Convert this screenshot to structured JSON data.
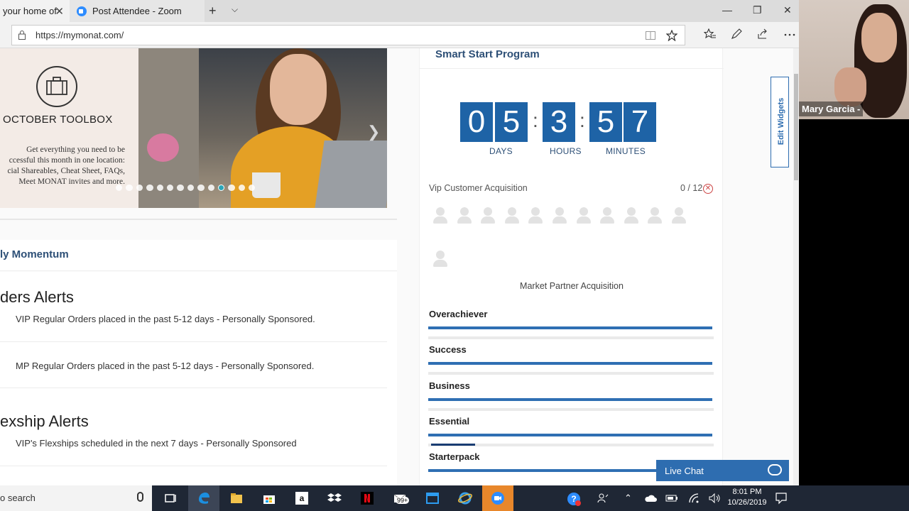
{
  "browser": {
    "tabs": [
      {
        "label": "your home of",
        "close": "✕"
      },
      {
        "label": "Post Attendee - Zoom"
      }
    ],
    "new_tab": "+",
    "tab_menu": "⌵",
    "url": "https://mymonat.com/",
    "window": {
      "minimize": "—",
      "restore": "❐",
      "close": "✕"
    }
  },
  "carousel": {
    "toolbox_title": "OCTOBER TOOLBOX",
    "toolbox_body": [
      "Get everything you need to be",
      "ccessful this month in one location:",
      "cial Shareables, Cheat Sheet, FAQs,",
      "Meet MONAT invites and more."
    ],
    "dots_total": 14,
    "active_dot": 10
  },
  "momentum": {
    "title": "ly Momentum",
    "orders_heading": "ders Alerts",
    "vip_orders": "VIP Regular Orders placed in the past 5-12 days - Personally Sponsored.",
    "mp_orders": "MP Regular Orders placed in the past 5-12 days - Personally Sponsored.",
    "flexship_heading": "exship Alerts",
    "vip_flexships": "VIP's Flexships scheduled in the next 7 days - Personally Sponsored"
  },
  "smart_start": {
    "title": "Smart Start Program",
    "days": [
      "0",
      "5"
    ],
    "hours": [
      "3"
    ],
    "minutes": [
      "5",
      "7"
    ],
    "colon": ":",
    "days_label": "DAYS",
    "hours_label": "HOURS",
    "minutes_label": "MINUTES",
    "vip_label": "Vip Customer Acquisition",
    "vip_count": "0 / 12",
    "vip_x": "✕",
    "mp_label": "Market Partner Acquisition",
    "tiers": [
      {
        "name": "Overachiever"
      },
      {
        "name": "Success"
      },
      {
        "name": "Business"
      },
      {
        "name": "Essential"
      },
      {
        "name": "Starterpack"
      }
    ]
  },
  "edit_widgets": "Edit Widgets",
  "live_chat": "Live Chat",
  "webcam": {
    "name": "Mary Garcia -"
  },
  "taskbar": {
    "search": "o search",
    "time": "8:01 PM",
    "date": "10/26/2019",
    "badge": "99+"
  },
  "colors": {
    "brand_blue": "#2e6db0",
    "countdown": "#1e63a6",
    "heading": "#2e5077"
  },
  "icons": [
    "lock-icon",
    "reading-view-icon",
    "favorite-star-icon",
    "favorites-icon",
    "pen-icon",
    "share-icon",
    "more-icon",
    "briefcase-icon",
    "chevron-right-icon",
    "person-icon",
    "circle-x-icon",
    "chat-bubble-icon",
    "mic-icon",
    "task-view-icon",
    "edge-icon",
    "file-explorer-icon",
    "store-icon",
    "amazon-icon",
    "dropbox-icon",
    "netflix-icon",
    "mail-icon",
    "window-icon",
    "ie-icon",
    "zoom-icon"
  ]
}
